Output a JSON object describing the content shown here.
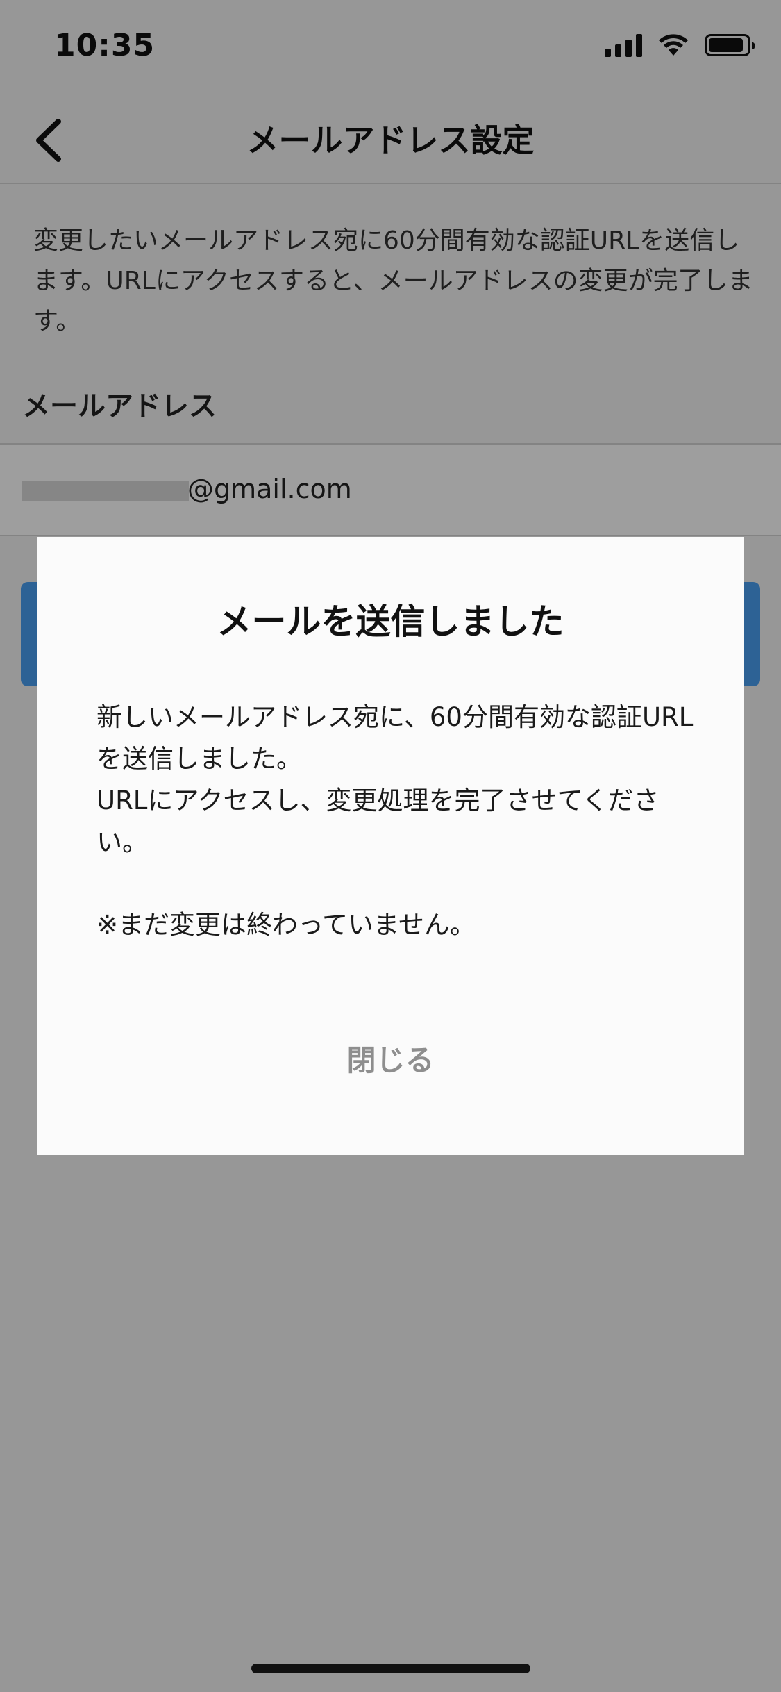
{
  "status_bar": {
    "time": "10:35"
  },
  "nav": {
    "title": "メールアドレス設定",
    "back_icon": "chevron-left-icon"
  },
  "content": {
    "description": "変更したいメールアドレス宛に60分間有効な認証URLを送信します。URLにアクセスすると、メールアドレスの変更が完了します。",
    "email_label": "メールアドレス",
    "email_value": "@gmail.com"
  },
  "dialog": {
    "title": "メールを送信しました",
    "body_line1": "新しいメールアドレス宛に、60分間有効な認証URLを送信しました。",
    "body_line2": "URLにアクセスし、変更処理を完了させてください。",
    "note": "※まだ変更は終わっていません。",
    "close_label": "閉じる"
  },
  "colors": {
    "accent": "#4a9ef0",
    "close_text": "#8e8e8e"
  }
}
